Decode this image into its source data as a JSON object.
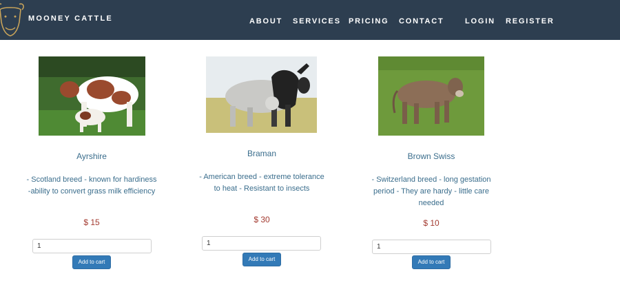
{
  "brand": {
    "name": "MOONEY CATTLE",
    "logo_icon": "cow-head-icon"
  },
  "nav": {
    "items": [
      {
        "label": "ABOUT"
      },
      {
        "label": "SERVICES"
      },
      {
        "label": "PRICING"
      },
      {
        "label": "CONTACT"
      },
      {
        "label": "LOGIN"
      },
      {
        "label": "REGISTER"
      }
    ]
  },
  "products": [
    {
      "name": "Ayrshire",
      "description": "- Scotland breed - known for hardiness -ability to convert grass milk efficiency",
      "price": "$ 15",
      "quantity": "1",
      "button_label": "Add to cart",
      "image": "ayrshire-cow-photo"
    },
    {
      "name": "Braman",
      "description": "- American breed - extreme tolerance to heat - Resistant to insects",
      "price": "$ 30",
      "quantity": "1",
      "button_label": "Add to cart",
      "image": "brahman-bull-photo"
    },
    {
      "name": "Brown Swiss",
      "description": "- Switzerland breed - long gestation period - They are hardy - little care needed",
      "price": "$ 10",
      "quantity": "1",
      "button_label": "Add to cart",
      "image": "brown-swiss-cow-photo"
    }
  ],
  "colors": {
    "navbar": "#2d3e50",
    "text_link": "#3a6d8c",
    "price": "#a33a30",
    "button": "#337ab7"
  }
}
